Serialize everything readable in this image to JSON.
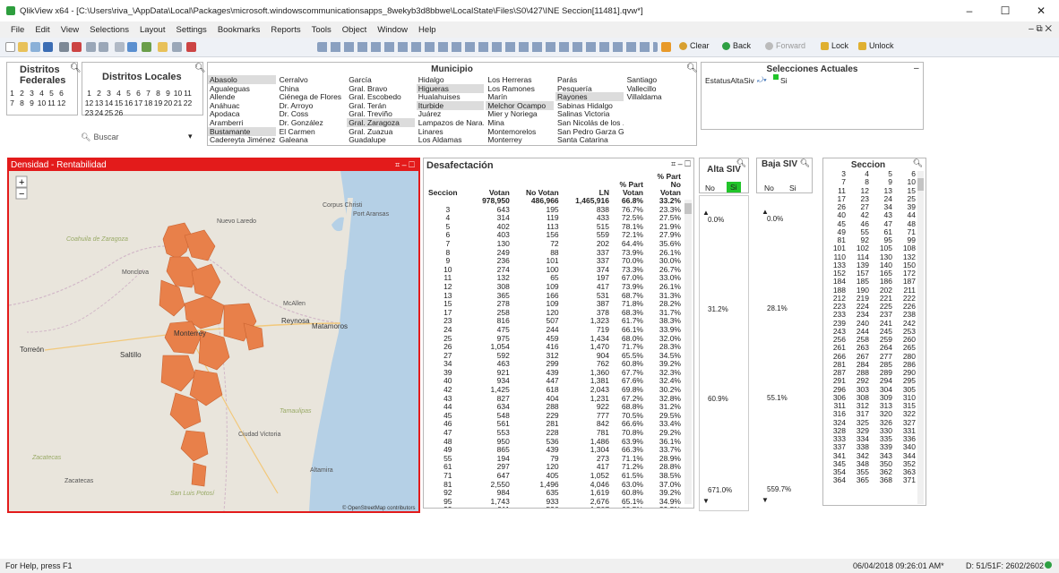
{
  "window": {
    "title": "QlikView x64 - [C:\\Users\\riva_\\AppData\\Local\\Packages\\microsoft.windowscommunicationsapps_8wekyb3d8bbwe\\LocalState\\Files\\S0\\427\\INE Seccion[11481].qvw*]",
    "minimize": "–",
    "maximize": "☐",
    "close": "✕"
  },
  "menu": [
    "File",
    "Edit",
    "View",
    "Selections",
    "Layout",
    "Settings",
    "Bookmarks",
    "Reports",
    "Tools",
    "Object",
    "Window",
    "Help"
  ],
  "menu_right": "– ⧉ ✕",
  "toolbar": {
    "clear": "Clear",
    "back": "Back",
    "forward": "Forward",
    "lock": "Lock",
    "unlock": "Unlock"
  },
  "distritos_federales": {
    "title": "Distritos Federales",
    "numbers": [
      "1",
      "2",
      "3",
      "4",
      "5",
      "6",
      "7",
      "8",
      "9",
      "10",
      "11",
      "12"
    ]
  },
  "distritos_locales": {
    "title": "Distritos Locales",
    "numbers": [
      "1",
      "2",
      "3",
      "4",
      "5",
      "6",
      "7",
      "8",
      "9",
      "10",
      "11",
      "12",
      "13",
      "14",
      "15",
      "16",
      "17",
      "18",
      "19",
      "20",
      "21",
      "22",
      "23",
      "24",
      "25",
      "26"
    ],
    "search": "Buscar"
  },
  "municipio": {
    "title": "Municipio",
    "columns": [
      [
        {
          "t": "Abasolo",
          "s": true
        },
        {
          "t": "Agualeguas"
        },
        {
          "t": "Allende"
        },
        {
          "t": "Anáhuac"
        },
        {
          "t": "Apodaca"
        },
        {
          "t": "Aramberri"
        },
        {
          "t": "Bustamante",
          "s": true
        },
        {
          "t": "Cadereyta Jiménez"
        }
      ],
      [
        {
          "t": "Cerralvo"
        },
        {
          "t": "China"
        },
        {
          "t": "Ciénega de Flores"
        },
        {
          "t": "Dr. Arroyo"
        },
        {
          "t": "Dr. Coss"
        },
        {
          "t": "Dr. González"
        },
        {
          "t": "El Carmen"
        },
        {
          "t": "Galeana"
        }
      ],
      [
        {
          "t": "García"
        },
        {
          "t": "Gral. Bravo"
        },
        {
          "t": "Gral. Escobedo"
        },
        {
          "t": "Gral. Terán"
        },
        {
          "t": "Gral. Treviño"
        },
        {
          "t": "Gral. Zaragoza",
          "s": true
        },
        {
          "t": "Gral. Zuazua"
        },
        {
          "t": "Guadalupe"
        }
      ],
      [
        {
          "t": "Hidalgo"
        },
        {
          "t": "Higueras",
          "s": true
        },
        {
          "t": "Hualahuises"
        },
        {
          "t": "Iturbide",
          "s": true
        },
        {
          "t": "Juárez"
        },
        {
          "t": "Lampazos de Nara..."
        },
        {
          "t": "Linares"
        },
        {
          "t": "Los Aldamas"
        }
      ],
      [
        {
          "t": "Los Herreras"
        },
        {
          "t": "Los Ramones"
        },
        {
          "t": "Marín"
        },
        {
          "t": "Melchor Ocampo",
          "s": true
        },
        {
          "t": "Mier y Noriega"
        },
        {
          "t": "Mina"
        },
        {
          "t": "Montemorelos"
        },
        {
          "t": "Monterrey"
        }
      ],
      [
        {
          "t": "Parás"
        },
        {
          "t": "Pesquería"
        },
        {
          "t": "Rayones",
          "s": true
        },
        {
          "t": "Sabinas Hidalgo"
        },
        {
          "t": "Salinas Victoria"
        },
        {
          "t": "San Nicolás de los ..."
        },
        {
          "t": "San Pedro Garza G..."
        },
        {
          "t": "Santa Catarina"
        }
      ],
      [
        {
          "t": "Santiago"
        },
        {
          "t": "Vallecillo"
        },
        {
          "t": "Villaldama"
        }
      ]
    ]
  },
  "selecciones": {
    "title": "Selecciones Actuales",
    "field": "EstatusAltaSiv",
    "value": "Si"
  },
  "map": {
    "title": "Densidad - Rentabilidad",
    "labels": [
      "Corpus Christi",
      "Port Aransas",
      "Nuevo Laredo",
      "Coahuila de Zaragoza",
      "Monclova",
      "McAllen",
      "Reynosa",
      "Matamoros",
      "Monterrey",
      "Torreón",
      "Saltillo",
      "Tamaulipas",
      "Ciudad Victoria",
      "Zacatecas",
      "Zacatecas",
      "Altamira",
      "San Luis Potosí"
    ],
    "attribution": "© OpenStreetMap contributors",
    "zoom_in": "+",
    "zoom_out": "−"
  },
  "desafectacion": {
    "title": "Desafectación",
    "headers": [
      "Seccion",
      "Votan",
      "No Votan",
      "LN",
      "% Part Votan",
      "% Part No Votan"
    ],
    "totals": [
      "",
      "978,950",
      "486,966",
      "1,465,916",
      "66.8%",
      "33.2%"
    ],
    "rows": [
      [
        "3",
        "643",
        "195",
        "838",
        "76.7%",
        "23.3%"
      ],
      [
        "4",
        "314",
        "119",
        "433",
        "72.5%",
        "27.5%"
      ],
      [
        "5",
        "402",
        "113",
        "515",
        "78.1%",
        "21.9%"
      ],
      [
        "6",
        "403",
        "156",
        "559",
        "72.1%",
        "27.9%"
      ],
      [
        "7",
        "130",
        "72",
        "202",
        "64.4%",
        "35.6%"
      ],
      [
        "8",
        "249",
        "88",
        "337",
        "73.9%",
        "26.1%"
      ],
      [
        "9",
        "236",
        "101",
        "337",
        "70.0%",
        "30.0%"
      ],
      [
        "10",
        "274",
        "100",
        "374",
        "73.3%",
        "26.7%"
      ],
      [
        "11",
        "132",
        "65",
        "197",
        "67.0%",
        "33.0%"
      ],
      [
        "12",
        "308",
        "109",
        "417",
        "73.9%",
        "26.1%"
      ],
      [
        "13",
        "365",
        "166",
        "531",
        "68.7%",
        "31.3%"
      ],
      [
        "15",
        "278",
        "109",
        "387",
        "71.8%",
        "28.2%"
      ],
      [
        "17",
        "258",
        "120",
        "378",
        "68.3%",
        "31.7%"
      ],
      [
        "23",
        "816",
        "507",
        "1,323",
        "61.7%",
        "38.3%"
      ],
      [
        "24",
        "475",
        "244",
        "719",
        "66.1%",
        "33.9%"
      ],
      [
        "25",
        "975",
        "459",
        "1,434",
        "68.0%",
        "32.0%"
      ],
      [
        "26",
        "1,054",
        "416",
        "1,470",
        "71.7%",
        "28.3%"
      ],
      [
        "27",
        "592",
        "312",
        "904",
        "65.5%",
        "34.5%"
      ],
      [
        "34",
        "463",
        "299",
        "762",
        "60.8%",
        "39.2%"
      ],
      [
        "39",
        "921",
        "439",
        "1,360",
        "67.7%",
        "32.3%"
      ],
      [
        "40",
        "934",
        "447",
        "1,381",
        "67.6%",
        "32.4%"
      ],
      [
        "42",
        "1,425",
        "618",
        "2,043",
        "69.8%",
        "30.2%"
      ],
      [
        "43",
        "827",
        "404",
        "1,231",
        "67.2%",
        "32.8%"
      ],
      [
        "44",
        "634",
        "288",
        "922",
        "68.8%",
        "31.2%"
      ],
      [
        "45",
        "548",
        "229",
        "777",
        "70.5%",
        "29.5%"
      ],
      [
        "46",
        "561",
        "281",
        "842",
        "66.6%",
        "33.4%"
      ],
      [
        "47",
        "553",
        "228",
        "781",
        "70.8%",
        "29.2%"
      ],
      [
        "48",
        "950",
        "536",
        "1,486",
        "63.9%",
        "36.1%"
      ],
      [
        "49",
        "865",
        "439",
        "1,304",
        "66.3%",
        "33.7%"
      ],
      [
        "55",
        "194",
        "79",
        "273",
        "71.1%",
        "28.9%"
      ],
      [
        "61",
        "297",
        "120",
        "417",
        "71.2%",
        "28.8%"
      ],
      [
        "71",
        "647",
        "405",
        "1,052",
        "61.5%",
        "38.5%"
      ],
      [
        "81",
        "2,550",
        "1,496",
        "4,046",
        "63.0%",
        "37.0%"
      ],
      [
        "92",
        "984",
        "635",
        "1,619",
        "60.8%",
        "39.2%"
      ],
      [
        "95",
        "1,743",
        "933",
        "2,676",
        "65.1%",
        "34.9%"
      ],
      [
        "99",
        "911",
        "596",
        "1,507",
        "60.5%",
        "39.5%"
      ]
    ]
  },
  "alta_siv": {
    "title": "Alta SIV",
    "no": "No",
    "si": "Si",
    "ticks": [
      "0.0%",
      "31.2%",
      "60.9%",
      "671.0%"
    ]
  },
  "baja_siv": {
    "title": "Baja SIV",
    "no": "No",
    "si": "Si",
    "ticks": [
      "0.0%",
      "28.1%",
      "55.1%",
      "559.7%"
    ]
  },
  "seccion": {
    "title": "Seccion",
    "values": [
      "3",
      "4",
      "5",
      "6",
      "7",
      "8",
      "9",
      "10",
      "11",
      "12",
      "13",
      "15",
      "17",
      "23",
      "24",
      "25",
      "26",
      "27",
      "34",
      "39",
      "40",
      "42",
      "43",
      "44",
      "45",
      "46",
      "47",
      "48",
      "49",
      "55",
      "61",
      "71",
      "81",
      "92",
      "95",
      "99",
      "101",
      "102",
      "105",
      "108",
      "110",
      "114",
      "130",
      "132",
      "133",
      "139",
      "140",
      "150",
      "152",
      "157",
      "165",
      "172",
      "184",
      "185",
      "186",
      "187",
      "188",
      "190",
      "202",
      "211",
      "212",
      "219",
      "221",
      "222",
      "223",
      "224",
      "225",
      "226",
      "233",
      "234",
      "237",
      "238",
      "239",
      "240",
      "241",
      "242",
      "243",
      "244",
      "245",
      "253",
      "256",
      "258",
      "259",
      "260",
      "261",
      "263",
      "264",
      "265",
      "266",
      "267",
      "277",
      "280",
      "281",
      "284",
      "285",
      "286",
      "287",
      "288",
      "289",
      "290",
      "291",
      "292",
      "294",
      "295",
      "296",
      "303",
      "304",
      "305",
      "306",
      "308",
      "309",
      "310",
      "311",
      "312",
      "313",
      "315",
      "316",
      "317",
      "320",
      "322",
      "324",
      "325",
      "326",
      "327",
      "328",
      "329",
      "330",
      "331",
      "333",
      "334",
      "335",
      "336",
      "337",
      "338",
      "339",
      "340",
      "341",
      "342",
      "343",
      "344",
      "345",
      "348",
      "350",
      "352",
      "354",
      "355",
      "362",
      "363",
      "364",
      "365",
      "368",
      "371"
    ]
  },
  "status": {
    "help": "For Help, press F1",
    "datetime": "06/04/2018 09:26:01 AM*",
    "d": "D: 51/51",
    "f": "F: 2602/2602"
  },
  "colors": {
    "accent_red": "#e31b1b",
    "region": "#e8804a",
    "water": "#b5d0e6",
    "green": "#21c42a"
  }
}
